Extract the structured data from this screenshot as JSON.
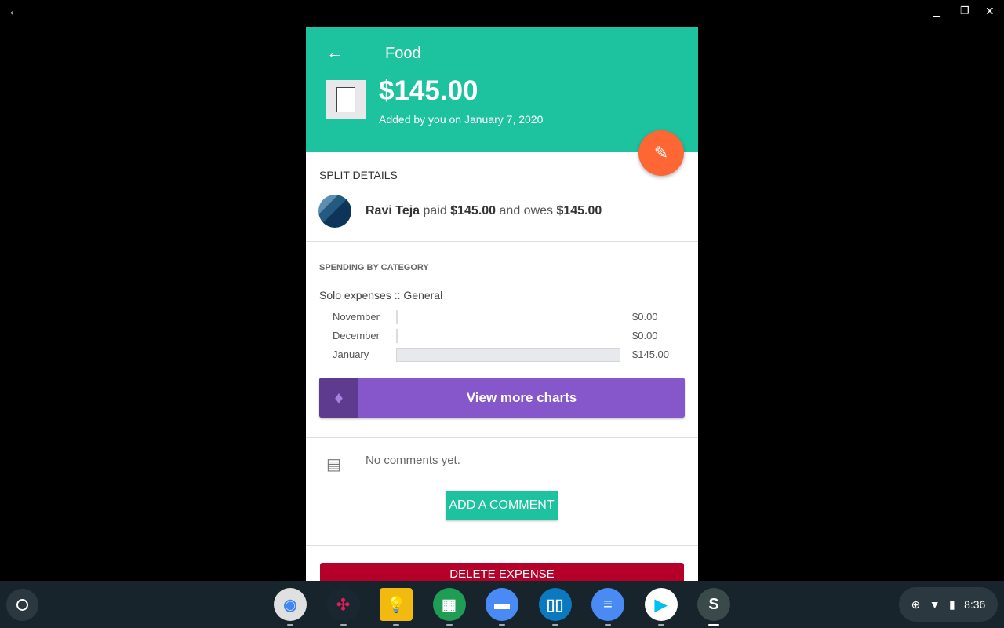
{
  "window": {
    "back_icon": "arrow-left",
    "minimize": "_",
    "maximize": "❐",
    "close": "✕"
  },
  "header": {
    "title": "Food",
    "amount": "$145.00",
    "added": "Added by you on January 7, 2020",
    "bg_color": "#1dc29f"
  },
  "split": {
    "title": "SPLIT DETAILS",
    "name": "Ravi Teja",
    "paid_word": "paid",
    "paid": "$145.00",
    "owes_word": "and owes",
    "owes": "$145.00"
  },
  "spending": {
    "title": "SPENDING BY CATEGORY",
    "subtitle": "Solo expenses :: General",
    "rows": [
      {
        "month": "November",
        "value": "$0.00",
        "amount": 0
      },
      {
        "month": "December",
        "value": "$0.00",
        "amount": 0
      },
      {
        "month": "January",
        "value": "$145.00",
        "amount": 145
      }
    ],
    "more_label": "View more charts"
  },
  "comments": {
    "empty": "No comments yet.",
    "add_label": "ADD A COMMENT"
  },
  "delete_label": "DELETE EXPENSE",
  "shelf": {
    "apps": [
      "Chrome",
      "Slack",
      "Keep",
      "Sheets",
      "Files",
      "Trello",
      "Docs",
      "Play Store",
      "Splitwise"
    ],
    "time": "8:36"
  }
}
